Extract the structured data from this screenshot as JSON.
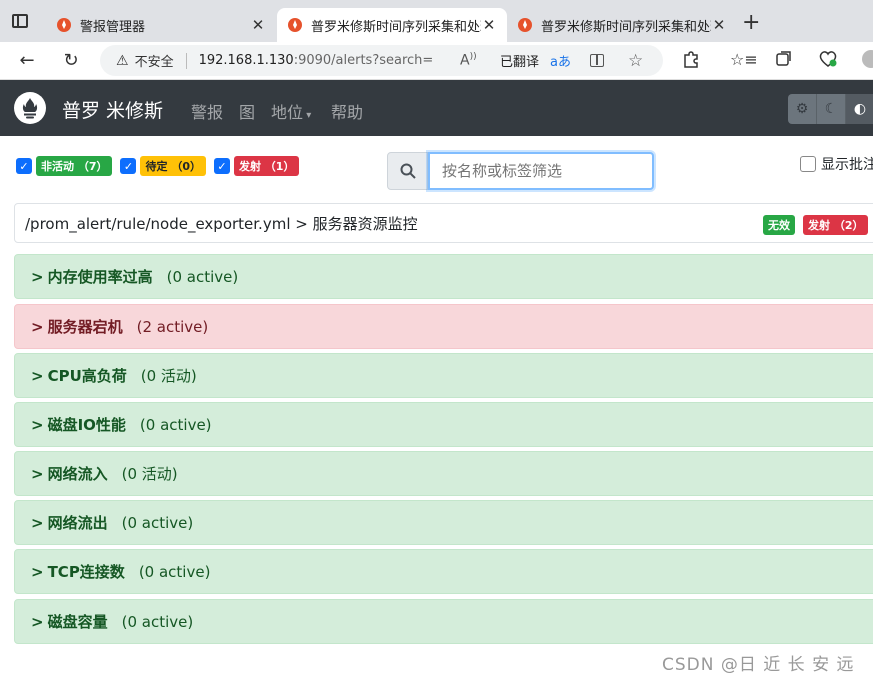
{
  "browser": {
    "tabs": [
      {
        "title": "警报管理器",
        "active": false
      },
      {
        "title": "普罗米修斯时间序列采集和处理",
        "active": true
      },
      {
        "title": "普罗米修斯时间序列采集和处理",
        "active": false
      }
    ],
    "insecure_label": "不安全",
    "url_host": "192.168.1.130",
    "url_path": ":9090/alerts?search=",
    "translated_label": "已翻译",
    "reader_icon": "A)",
    "translate_glyph": "ȃ"
  },
  "navbar": {
    "brand": "普罗 米修斯",
    "links": {
      "alerts": "警报",
      "graph": "图",
      "status": "地位",
      "help": "帮助"
    }
  },
  "filters": {
    "inactive": "非活动 （7）",
    "pending": "待定 （0）",
    "firing": "发射 （1）",
    "search_placeholder": "按名称或标签筛选",
    "show_annotations": "显示批注"
  },
  "rulefile": {
    "path": "/prom_alert/rule/node_exporter.yml > 服务器资源监控",
    "badge_invalid": "无效",
    "badge_firing": "发射 （2）"
  },
  "groups": [
    {
      "name": "内存使用率过高",
      "count": "(0 active)",
      "state": "ok"
    },
    {
      "name": "服务器宕机",
      "count": "(2 active)",
      "state": "firing"
    },
    {
      "name": "CPU高负荷",
      "count": "(0 活动)",
      "state": "ok"
    },
    {
      "name": "磁盘IO性能",
      "count": "(0 active)",
      "state": "ok"
    },
    {
      "name": "网络流入",
      "count": "(0 活动)",
      "state": "ok"
    },
    {
      "name": "网络流出",
      "count": "(0 active)",
      "state": "ok"
    },
    {
      "name": "TCP连接数",
      "count": "(0 active)",
      "state": "ok"
    },
    {
      "name": "磁盘容量",
      "count": "(0 active)",
      "state": "ok"
    }
  ],
  "watermark": "CSDN @日 近 长 安 远"
}
